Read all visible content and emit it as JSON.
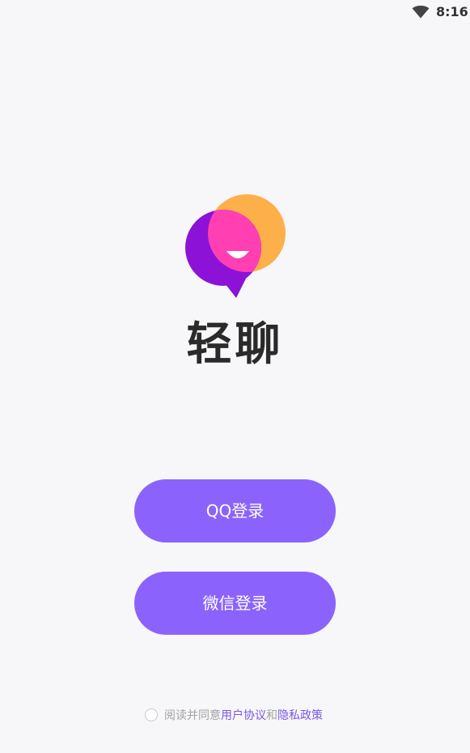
{
  "status_bar": {
    "time": "8:16",
    "wifi_icon": "wifi-icon"
  },
  "app": {
    "logo_icon": "chat-bubble-smile-logo",
    "name": "轻聊"
  },
  "buttons": {
    "qq_login": "QQ登录",
    "wechat_login": "微信登录"
  },
  "agreement": {
    "checkbox_icon": "circle-checkbox-icon",
    "prefix": "阅读并同意",
    "user_agreement": "用户协议",
    "conjunction": "和",
    "privacy_policy": "隐私政策"
  },
  "colors": {
    "background": "#f7f7f9",
    "button": "#8b63fc",
    "link": "#7b55e6",
    "logo_orange": "#fdb04a",
    "logo_purple": "#8b12d6",
    "logo_pink": "#ff3fb2"
  }
}
